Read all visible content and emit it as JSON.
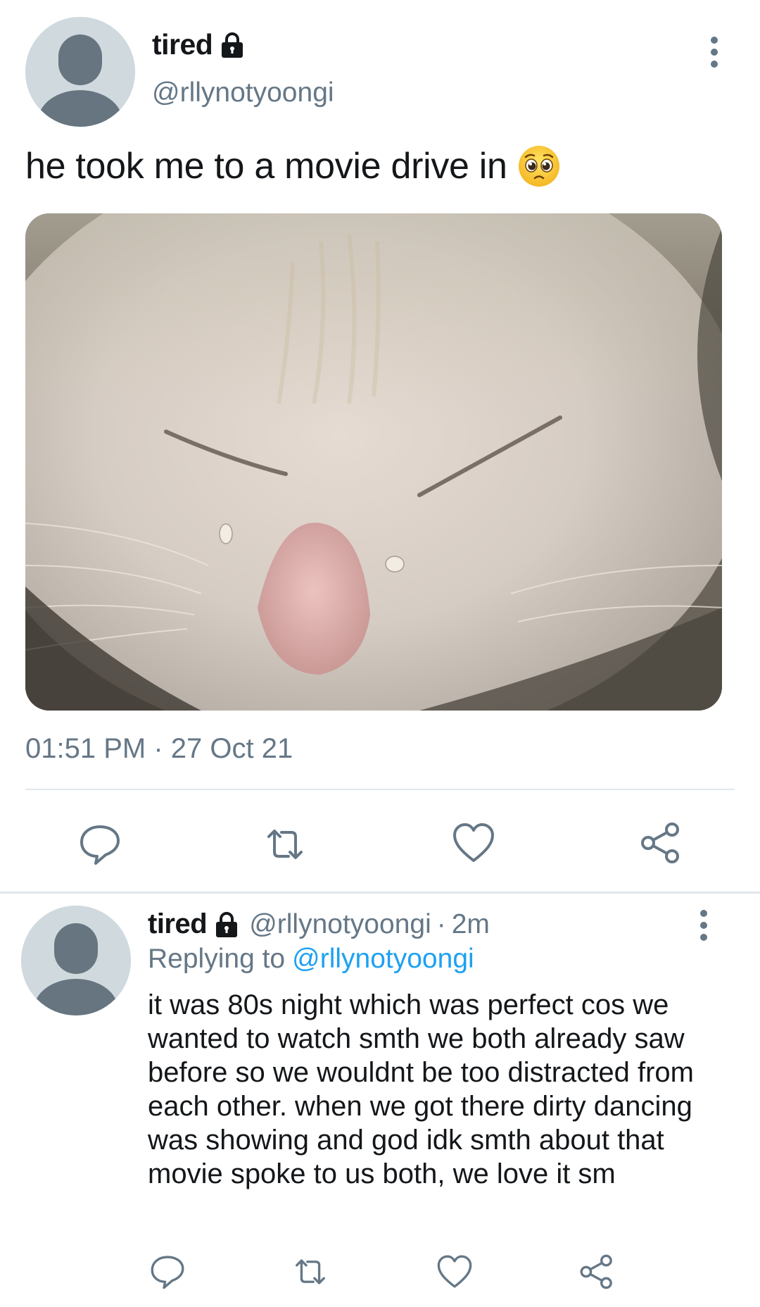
{
  "main_tweet": {
    "display_name": "tired",
    "handle": "@rllynotyoongi",
    "text": "he took me to a movie drive in",
    "emoji_icon": "pleading-face-icon",
    "media_description_icon": "crying-cat-photo",
    "timestamp": "01:51 PM · 27 Oct 21",
    "actions": [
      "reply-icon",
      "retweet-icon",
      "like-icon",
      "share-icon"
    ]
  },
  "reply_tweet": {
    "display_name": "tired",
    "handle": "@rllynotyoongi",
    "separator": "·",
    "time": "2m",
    "replying_label": "Replying to",
    "replying_to": "@rllynotyoongi",
    "text": "it was 80s night which was perfect cos we wanted to watch smth we both already saw before so we wouldnt be too distracted from each other. when we got there dirty dancing was showing and god idk smth about that movie spoke to us both, we love it sm",
    "actions": [
      "reply-icon",
      "retweet-icon",
      "like-icon",
      "share-icon"
    ]
  },
  "colors": {
    "text_primary": "#14171a",
    "text_secondary": "#657786",
    "link": "#1da1f2",
    "divider": "#e1e8ed",
    "avatar_bg": "#cfd9de",
    "avatar_fg": "#66757f"
  }
}
